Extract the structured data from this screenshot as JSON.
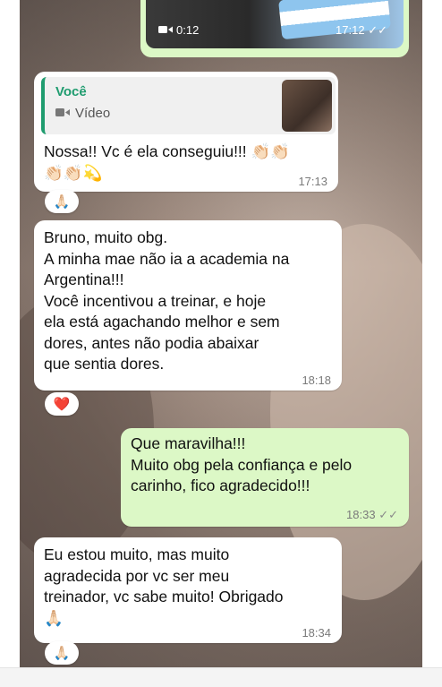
{
  "video_message": {
    "duration": "0:12",
    "time": "17:12",
    "status_icon": "double-check-icon"
  },
  "messages": [
    {
      "id": "m1",
      "direction": "incoming",
      "reply_to": {
        "author": "Você",
        "kind": "Vídeo"
      },
      "text": "Nossa!! Vc é ela conseguiu!!! 👏🏻👏🏻\n👏🏻👏🏻💫",
      "time": "17:13",
      "reaction": "🙏🏻"
    },
    {
      "id": "m2",
      "direction": "incoming",
      "text": "Bruno, muito obg.\nA minha mae não ia a academia na\nArgentina!!!\nVocê incentivou a treinar, e hoje\nela está agachando melhor e sem\ndores, antes não podia abaixar\nque sentia dores.",
      "time": "18:18",
      "reaction": "❤️"
    },
    {
      "id": "m3",
      "direction": "outgoing",
      "text": "Que maravilha!!!\nMuito obg pela confiança e pelo\ncarinho, fico agradecido!!!",
      "time": "18:33",
      "status_icon": "double-check-icon"
    },
    {
      "id": "m4",
      "direction": "incoming",
      "text": "Eu estou muito, mas muito\nagradecida por vc ser meu\ntreinador, vc sabe muito! Obrigado\n🙏🏻",
      "time": "18:34",
      "reaction": "🙏🏻"
    }
  ],
  "colors": {
    "incoming_bubble": "#ffffff",
    "outgoing_bubble": "#dcf8c6",
    "quote_accent": "#1f9c6f",
    "timestamp": "#7a7a7a"
  }
}
